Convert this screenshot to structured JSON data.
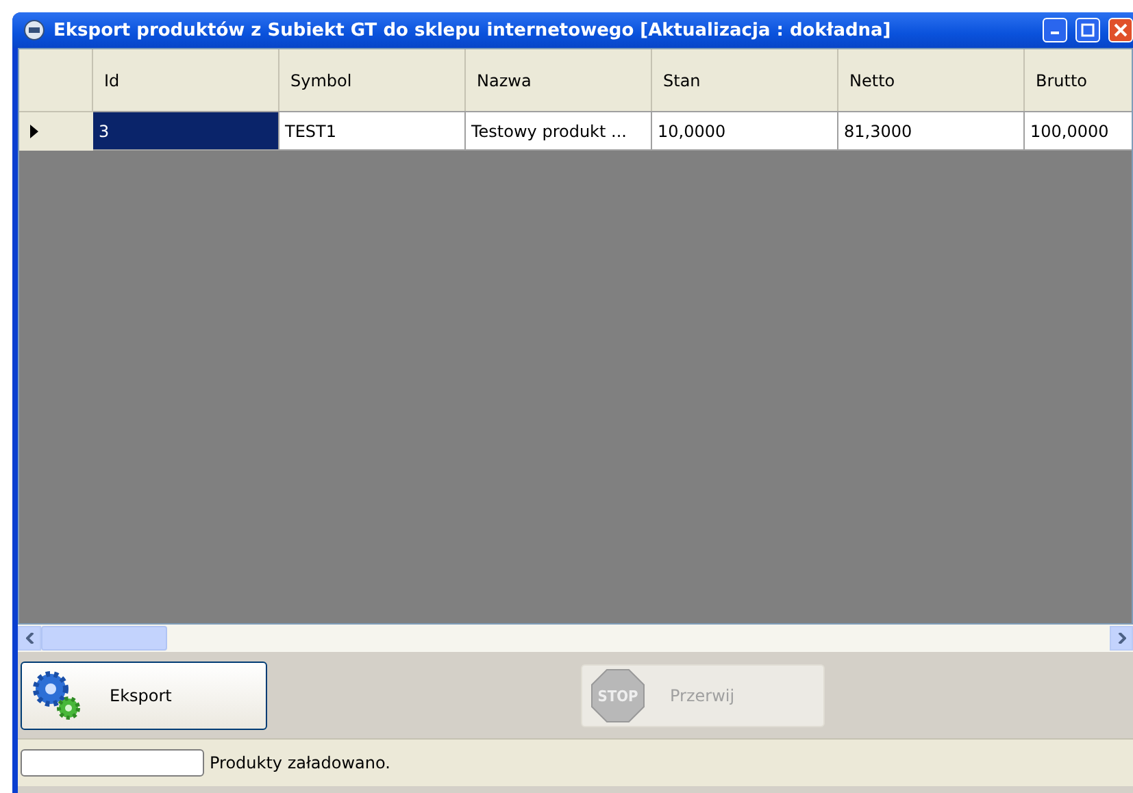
{
  "window": {
    "title": "Eksport produktów z Subiekt GT do sklepu internetowego [Aktualizacja : dokładna]"
  },
  "table": {
    "columns": [
      "Id",
      "Symbol",
      "Nazwa",
      "Stan",
      "Netto",
      "Brutto"
    ],
    "rows": [
      {
        "selected": true,
        "cells": [
          {
            "text": "3",
            "selected": true
          },
          {
            "text": "TEST1",
            "selected": false
          },
          {
            "text": "Testowy produkt ...",
            "selected": false
          },
          {
            "text": "10,0000",
            "selected": false
          },
          {
            "text": "81,3000",
            "selected": false
          },
          {
            "text": "100,0000",
            "selected": false
          }
        ]
      }
    ]
  },
  "buttons": [
    {
      "kind": "export",
      "label": "Eksport",
      "disabled": false
    },
    {
      "kind": "stop",
      "label": "Przerwij",
      "icon_text": "STOP",
      "disabled": true
    }
  ],
  "status_bar": {
    "message": "Produkty załadowano."
  }
}
